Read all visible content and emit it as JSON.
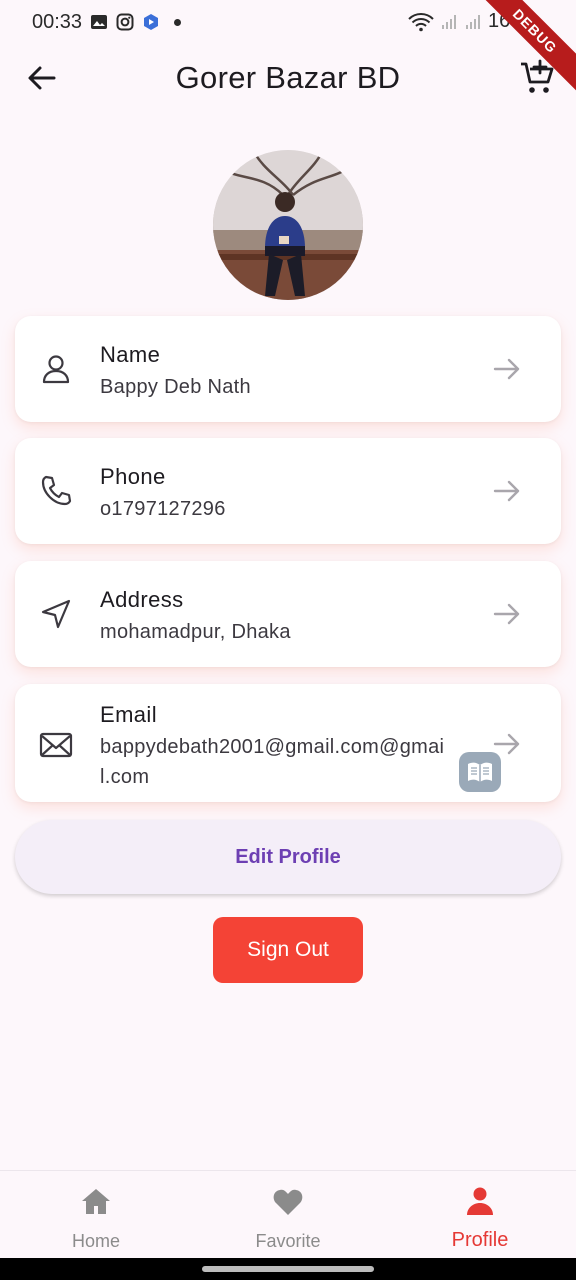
{
  "status_bar": {
    "time": "00:33",
    "battery": "16%",
    "debug": "DEBUG"
  },
  "app_bar": {
    "title": "Gorer Bazar BD",
    "back_icon": "arrow-left-icon",
    "cart_icon": "cart-add-icon"
  },
  "profile": {
    "fields": [
      {
        "label": "Name",
        "value": "Bappy Deb Nath",
        "icon": "person-icon"
      },
      {
        "label": "Phone",
        "value": "o1797127296",
        "icon": "phone-icon"
      },
      {
        "label": "Address",
        "value": "mohamadpur, Dhaka",
        "icon": "location-arrow-icon"
      },
      {
        "label": "Email",
        "value_line1": "bappydebath2001@gmail.com@gmai",
        "value_line2": "l.com",
        "icon": "mail-icon"
      }
    ]
  },
  "actions": {
    "edit_label": "Edit Profile",
    "signout_label": "Sign Out"
  },
  "bottom_nav": [
    {
      "label": "Home",
      "icon": "home-icon",
      "active": false
    },
    {
      "label": "Favorite",
      "icon": "heart-icon",
      "active": false
    },
    {
      "label": "Profile",
      "icon": "person-icon",
      "active": true
    }
  ],
  "colors": {
    "accent": "#e53935",
    "signout": "#f44336",
    "edit_text": "#6d3fb3",
    "background": "#fdf7fb"
  }
}
